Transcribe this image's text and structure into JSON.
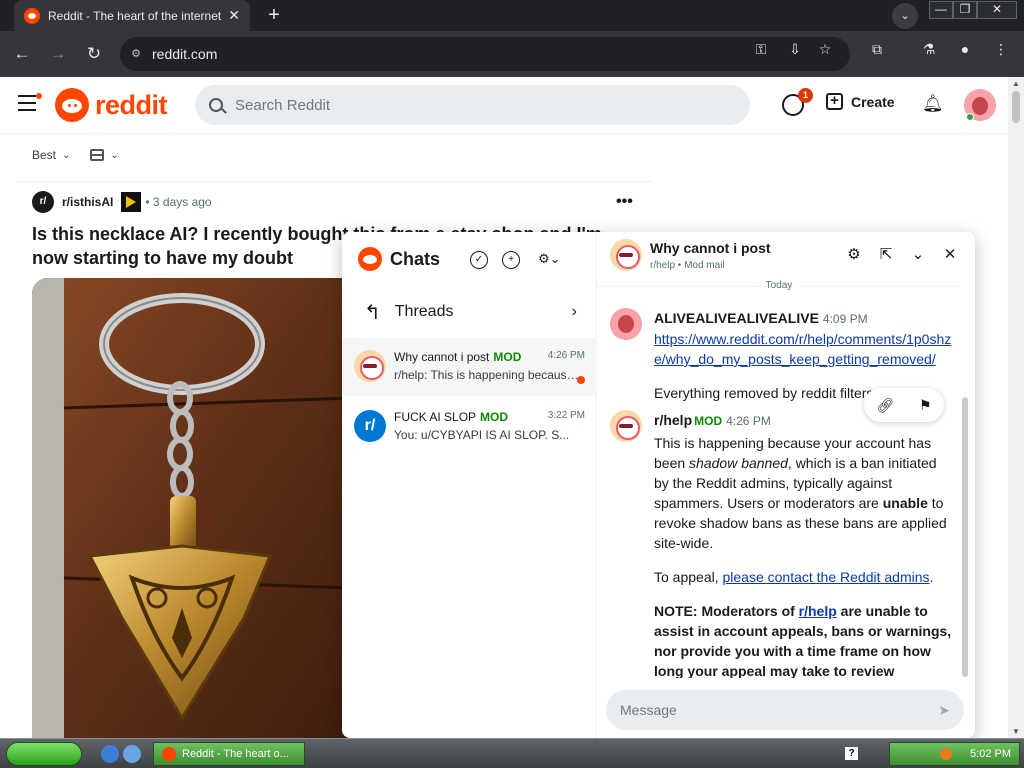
{
  "browser": {
    "tab_title": "Reddit - The heart of the internet",
    "tab_close": "✕",
    "new_tab": "+",
    "url": "reddit.com",
    "win_min": "—",
    "win_max": "❐",
    "win_close": "✕"
  },
  "header": {
    "logo_text": "reddit",
    "search_placeholder": "Search Reddit",
    "chat_badge": "1",
    "create_label": "Create"
  },
  "feed": {
    "sort_label": "Best",
    "post": {
      "subreddit": "r/isthisAI",
      "age": "• 3 days ago",
      "title": "Is this necklace AI? I recently bought this from a etsy shop and I'm now starting to have my doubt",
      "more": "•••"
    }
  },
  "chat": {
    "title": "Chats",
    "threads_label": "Threads",
    "rows": [
      {
        "name": "Why cannot i post",
        "mod": "MOD",
        "time": "4:26 PM",
        "preview": "r/help: This is happening because your account has been",
        "unread": true
      },
      {
        "name": "FUCK AI SLOP",
        "mod": "MOD",
        "time": "3:22 PM",
        "preview": "You: u/CYBYAPI IS AI SLOP. S...",
        "unread": false
      }
    ],
    "conversation": {
      "title": "Why cannot i post",
      "subtitle": "r/help • Mod mail",
      "day_divider": "Today",
      "messages": [
        {
          "author": "ALIVEALIVEALIVEALIVE",
          "time": "4:09 PM",
          "link": "https://www.reddit.com/r/help/comments/1p0shze/why_do_my_posts_keep_getting_removed/",
          "text": "Everything removed by reddit filters"
        },
        {
          "author": "r/help",
          "mod": "MOD",
          "time": "4:26 PM",
          "p1_a": "This is happening because your account has been ",
          "p1_em": "shadow banned",
          "p1_b": ", which is a ban initiated by the Reddit admins, typically against spammers. Users or moderators are ",
          "p1_strong": "unable",
          "p1_c": " to revoke shadow bans as these bans are applied site-wide.",
          "p2_a": "To appeal, ",
          "p2_link": "please contact the Reddit admins",
          "p2_b": ".",
          "p3_a": "NOTE: Moderators of ",
          "p3_link": "r/help",
          "p3_b": " are unable to assist in account appeals, bans or warnings, nor provide you with a time frame on how long your appeal may take to review"
        }
      ],
      "composer_placeholder": "Message"
    }
  },
  "taskbar": {
    "task_title": "Reddit - The heart o...",
    "help": "?",
    "clock": "5:02 PM"
  },
  "colors": {
    "brand": "#ff4500",
    "mod_green": "#0e8a00",
    "link": "#0b3aab"
  }
}
